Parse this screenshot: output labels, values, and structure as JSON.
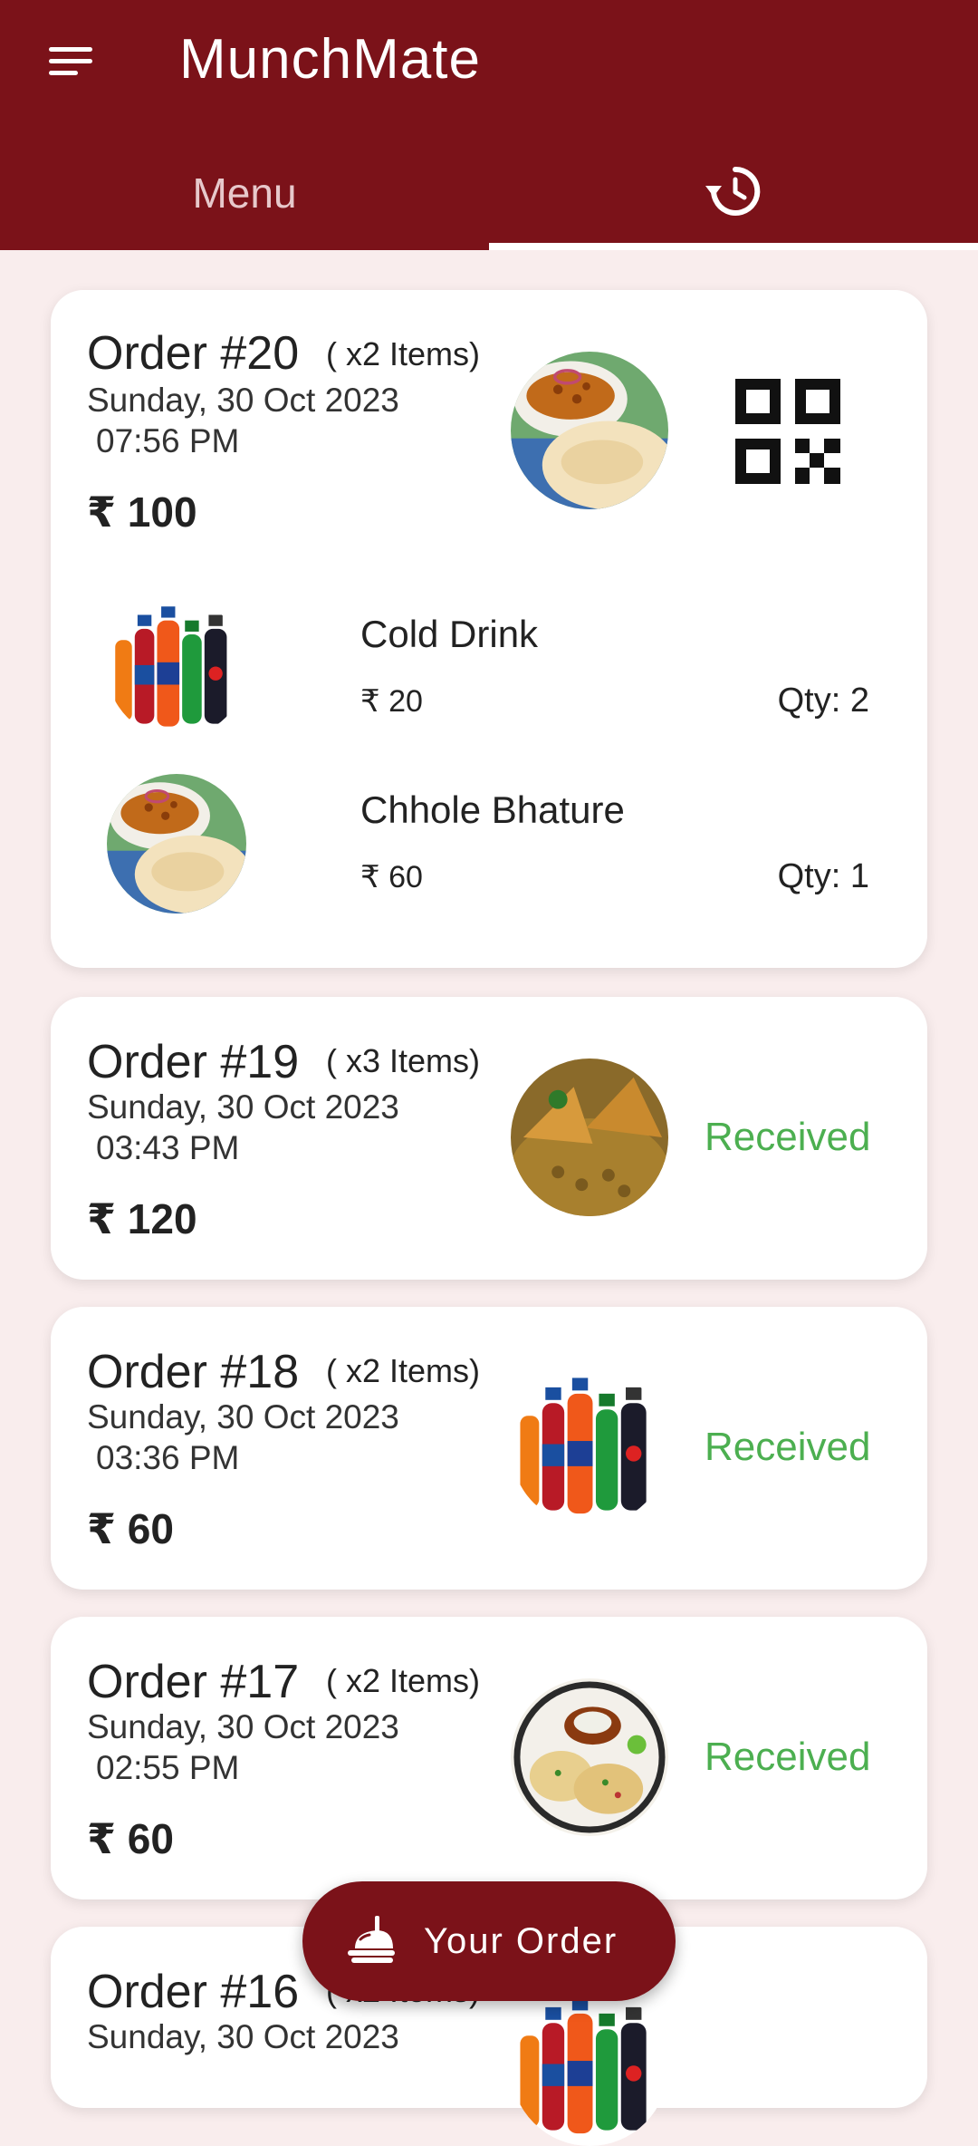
{
  "app": {
    "title": "MunchMate"
  },
  "tabs": {
    "menu_label": "Menu",
    "history_icon": "history-icon"
  },
  "orders": [
    {
      "title": "Order #20",
      "count": "( x2 Items)",
      "date": "Sunday, 30 Oct 2023",
      "time": "07:56 PM",
      "price": "₹ 100",
      "action": "qr-code-icon",
      "items": [
        {
          "name": "Cold Drink",
          "price": "₹ 20",
          "qty": "Qty: 2"
        },
        {
          "name": "Chhole Bhature",
          "price": "₹ 60",
          "qty": "Qty: 1"
        }
      ]
    },
    {
      "title": "Order #19",
      "count": "( x3 Items)",
      "date": "Sunday, 30 Oct 2023",
      "time": "03:43 PM",
      "price": "₹ 120",
      "status": "Received"
    },
    {
      "title": "Order #18",
      "count": "( x2 Items)",
      "date": "Sunday, 30 Oct 2023",
      "time": "03:36 PM",
      "price": "₹ 60",
      "status": "Received"
    },
    {
      "title": "Order #17",
      "count": "( x2 Items)",
      "date": "Sunday, 30 Oct 2023",
      "time": "02:55 PM",
      "price": "₹ 60",
      "status": "Received"
    },
    {
      "title": "Order #16",
      "count": "( x2 Items)",
      "date": "Sunday, 30 Oct 2023"
    }
  ],
  "fab": {
    "label": "Your Order",
    "icon": "food-serving-icon"
  },
  "colors": {
    "primary": "#7b1219",
    "background": "#f9eded",
    "status_received": "#4caf50"
  }
}
